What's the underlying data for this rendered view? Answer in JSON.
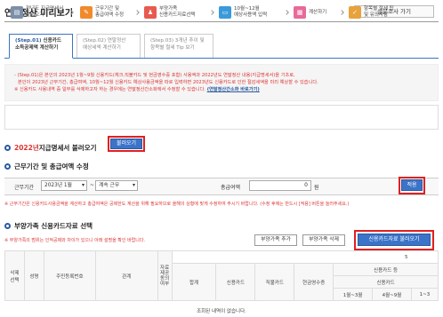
{
  "page": {
    "title": "연말정산 미리보기",
    "survey_button": "설문조사 가기"
  },
  "tabs": [
    {
      "step": "(Step.01)",
      "label1": "신용카드",
      "label2": "소득공제액 계산하기"
    },
    {
      "step": "(Step.02)",
      "label1": "연말정산",
      "label2": "예상세액 계산하기"
    },
    {
      "step": "(Step.03)",
      "label1": "3개년 추이 및",
      "label2": "항목별 절세 Tip 보기"
    }
  ],
  "notice": {
    "line1": "- (Step.01)은 본인의 2023년 1월~9월 신용카드(체크,직불카드 및 현금영수증 포함) 사용액과 2022년도 연말정산 내용(지급명세서)을 기초로,",
    "line2": "본인이 2023년 근무기간, 총급여액, 10월~12월 신용카드 예상사용금액을 따로 입력하면 2023년도 신용카드로 인한 절감세액을 미리 예상할 수 있습니다.",
    "line3": "※ 신용카드 사용내역 중 일부를 삭제하고자 하는 경우에는 연말정산간소화에서 수정할 수 있습니다.",
    "link": "(연말정산간소화 바로가기)"
  },
  "steps": [
    {
      "label1": "전년도 지급명세서",
      "label2": "불러오기",
      "color": "#7b8fa8",
      "icon": "document-icon"
    },
    {
      "label1": "근무기간 및",
      "label2": "총급여액 수정",
      "color": "#f08a2c",
      "icon": "edit-icon"
    },
    {
      "label1": "부양가족",
      "label2": "신용카드자료선택",
      "color": "#e85a4f",
      "icon": "family-icon"
    },
    {
      "label1": "10월~12월",
      "label2": "예상사용액 입력",
      "color": "#3b9ad9",
      "icon": "card-icon"
    },
    {
      "label1": "계산하기",
      "label2": "",
      "color": "#e86a9a",
      "icon": "calculator-icon"
    },
    {
      "label1": "항목별 절세 팁",
      "label2": "및 유의사항",
      "color": "#e8a23c",
      "icon": "tip-icon"
    }
  ],
  "section1": {
    "title_prefix": "2022년",
    "title_rest": " 지급명세서 불러오기",
    "button": "불러오기"
  },
  "section2": {
    "title": "근무기간 및 총급여액 수정",
    "period_label": "근무기간",
    "period_start": "2023년 1월",
    "period_sep": "~",
    "period_end": "계속 근무",
    "salary_label": "총급여액",
    "salary_value": "0",
    "salary_unit": "원",
    "apply_button": "적용",
    "note": "※ 근무기간은 신용카드사용금액을 계산하고 총급여액은 공제한도 계산을 위해 필요하므로 올해의 상황에 맞게 수정하여 주시기 바랍니다. (수정 후에는 반드시 [적용] 버튼을 눌러주세요.)"
  },
  "section3": {
    "title": "부양가족 신용카드자료 선택",
    "note": "※ 부양가족의 범위는 인적공제와 차이가 있으니 아래 설명을 확인 바랍니다.",
    "add_button": "부양가족 추가",
    "delete_button": "부양가족 삭제",
    "load_button": "신용카드자료 불러오기"
  },
  "table": {
    "col_delete": "삭제\n선택",
    "col_name": "성명",
    "col_rrn": "주민등록번호",
    "col_relation": "관계",
    "col_consent": "자료\n제공\n동의\n여부",
    "col_total": "합계",
    "col_credit": "신용카드",
    "col_debit": "직불카드",
    "col_cash": "현금영수증",
    "group_credit": "신용카드 등",
    "sub_credit": "신용카드",
    "month1": "1월~3월",
    "month2": "4월~9월",
    "month3": "1~3",
    "edge5": "5",
    "empty": "조회된 내역이 없습니다."
  }
}
